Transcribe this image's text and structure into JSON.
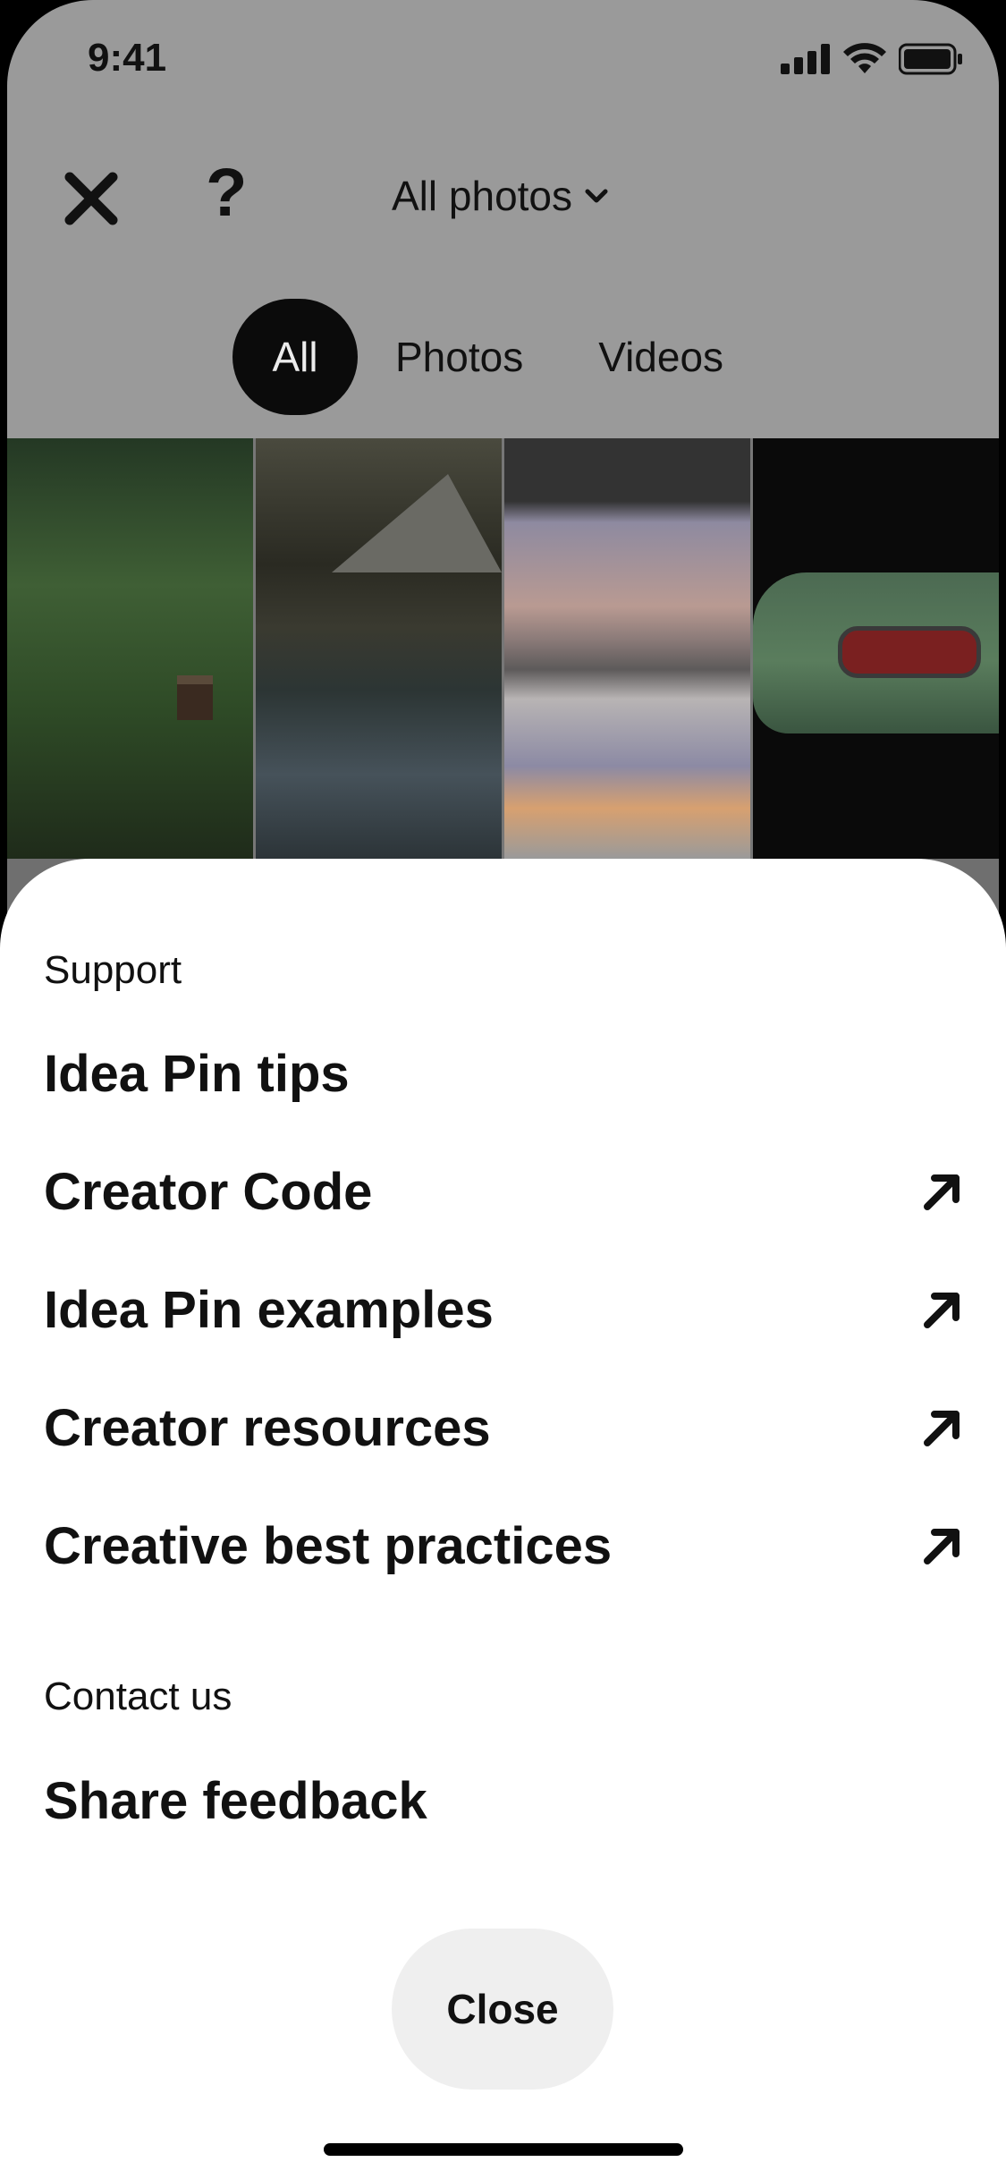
{
  "status_bar": {
    "time": "9:41",
    "icons": [
      "cellular-signal-icon",
      "wifi-icon",
      "battery-icon"
    ]
  },
  "top_bar": {
    "close_icon": "close-icon",
    "help_glyph": "?",
    "album_label": "All photos",
    "album_chevron": "chevron-down-icon"
  },
  "filter_tabs": [
    {
      "label": "All",
      "active": true
    },
    {
      "label": "Photos",
      "active": false
    },
    {
      "label": "Videos",
      "active": false
    }
  ],
  "thumbnails": [
    "forest-cabin",
    "mountain-lake",
    "sunset-reflection",
    "green-car"
  ],
  "sheet": {
    "support_label": "Support",
    "items": [
      {
        "label": "Idea Pin tips",
        "external": false
      },
      {
        "label": "Creator Code",
        "external": true
      },
      {
        "label": "Idea Pin examples",
        "external": true
      },
      {
        "label": "Creator resources",
        "external": true
      },
      {
        "label": "Creative best practices",
        "external": true
      }
    ],
    "contact_label": "Contact us",
    "contact_items": [
      {
        "label": "Share feedback",
        "external": false
      }
    ],
    "close_label": "Close"
  },
  "colors": {
    "overlay": "#9a9a9a",
    "active_tab": "#0b0b0b",
    "sheet": "#ffffff",
    "close_button": "#efefef",
    "text": "#111111"
  }
}
